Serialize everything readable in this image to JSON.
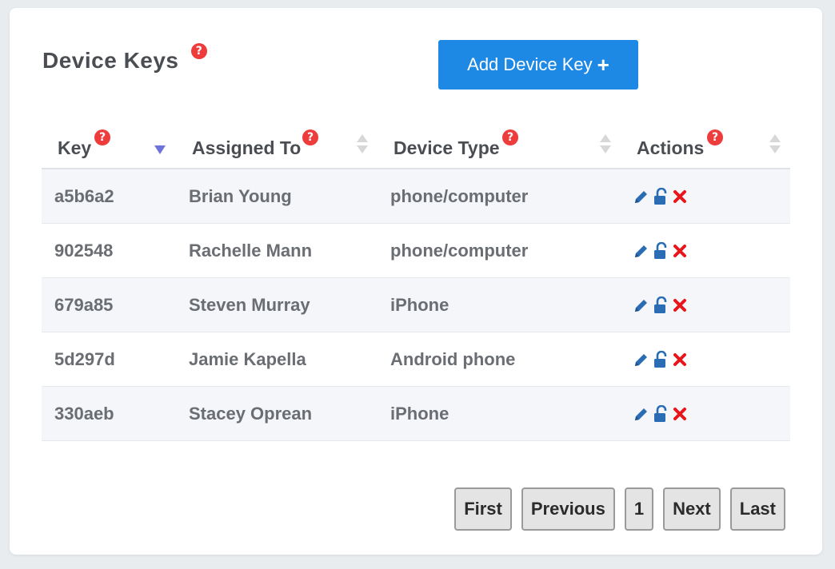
{
  "header": {
    "title": "Device Keys",
    "help_glyph": "?",
    "add_button_label": "Add Device Key",
    "add_button_icon": "+"
  },
  "table": {
    "columns": [
      {
        "label": "Key",
        "help": "?",
        "sort": "descending"
      },
      {
        "label": "Assigned To",
        "help": "?",
        "sort": "none"
      },
      {
        "label": "Device Type",
        "help": "?",
        "sort": "none"
      },
      {
        "label": "Actions",
        "help": "?",
        "sort": "none"
      }
    ],
    "rows": [
      {
        "key": "a5b6a2",
        "assigned_to": "Brian Young",
        "device_type": "phone/computer"
      },
      {
        "key": "902548",
        "assigned_to": "Rachelle Mann",
        "device_type": "phone/computer"
      },
      {
        "key": "679a85",
        "assigned_to": "Steven Murray",
        "device_type": "iPhone"
      },
      {
        "key": "5d297d",
        "assigned_to": "Jamie Kapella",
        "device_type": "Android phone"
      },
      {
        "key": "330aeb",
        "assigned_to": "Stacey Oprean",
        "device_type": "iPhone"
      }
    ],
    "row_actions": [
      "pencil-icon",
      "unlock-icon",
      "delete-x-icon"
    ]
  },
  "pagination": {
    "first": "First",
    "previous": "Previous",
    "current_page": "1",
    "next": "Next",
    "last": "Last"
  },
  "colors": {
    "accent": "#1e88e5",
    "help_badge": "#ee3b3b",
    "action_icon": "#2a6db5",
    "delete_icon": "#e8161b",
    "sort_active": "#6f73d9"
  }
}
